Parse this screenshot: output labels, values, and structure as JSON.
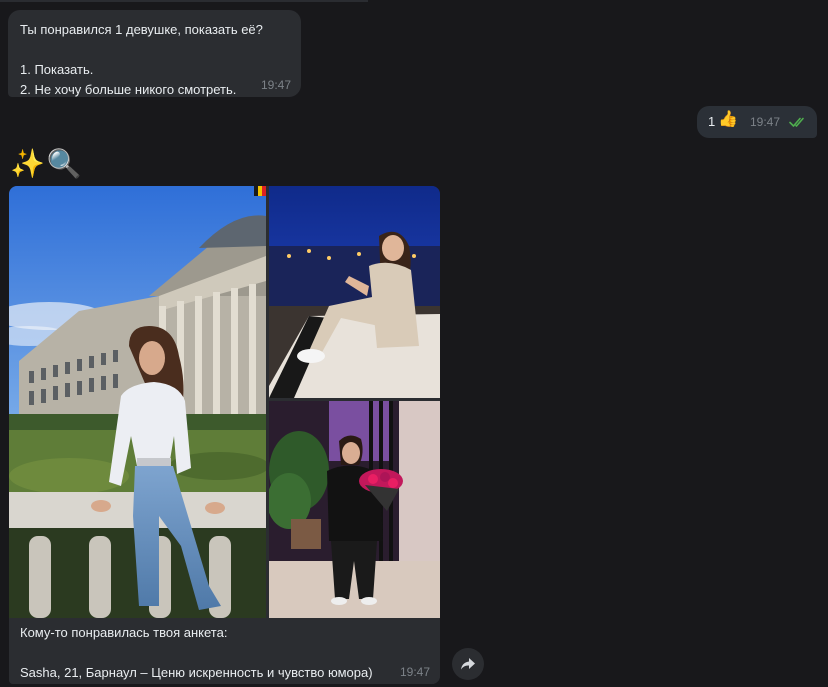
{
  "messages": [
    {
      "direction": "in",
      "text": "Ты понравился 1 девушке, показать её?\n\n1. Показать.\n2. Не хочу больше никого смотреть.",
      "time": "19:47"
    },
    {
      "direction": "out",
      "text": "1",
      "emoji": "👍",
      "time": "19:47",
      "status": "read"
    }
  ],
  "emoji_message": {
    "sparkles": "✨",
    "magnifier": "🔍"
  },
  "media_message": {
    "photo_count": 3,
    "caption": "Кому-то понравилась твоя анкета:\n\nSasha, 21, Барнаул – Ценю искренность и чувство юмора)",
    "time": "19:47"
  },
  "icons": {
    "read_checks": "double-check-icon",
    "forward": "forward-icon"
  },
  "colors": {
    "background": "#18181b",
    "bubble_in": "#2b2d31",
    "bubble_out": "#2b3037",
    "read_check": "#4fae4e",
    "time_text": "#7c8288"
  }
}
